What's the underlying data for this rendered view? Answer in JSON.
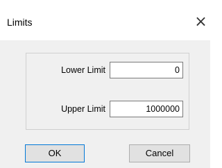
{
  "window": {
    "title": "Limits",
    "close_glyph": "×"
  },
  "fields": {
    "lower": {
      "label": "Lower Limit",
      "value": "0"
    },
    "upper": {
      "label": "Upper Limit",
      "value": "1000000"
    }
  },
  "buttons": {
    "ok_label": "OK",
    "cancel_label": "Cancel"
  },
  "colors": {
    "accent": "#0078d7",
    "dialog_bg": "#f0f0f0",
    "title_bg": "#ffffff"
  },
  "icons": {
    "close": "close-icon"
  }
}
